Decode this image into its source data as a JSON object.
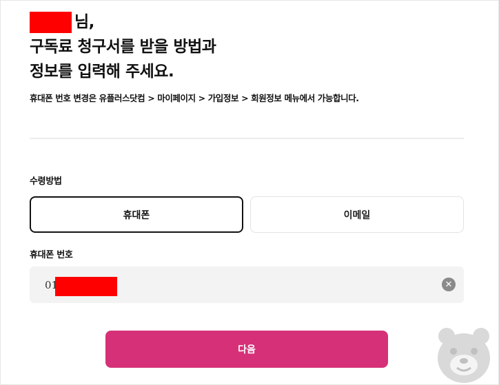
{
  "greeting": {
    "name_suffix": "님,",
    "line2": "구독료 청구서를 받을 방법과",
    "line3": "정보를 입력해 주세요."
  },
  "notice": "휴대폰 번호 변경은 유플러스닷컴 > 마이페이지 > 가입정보 > 회원정보 메뉴에서 가능합니다.",
  "receive_method": {
    "label": "수령방법",
    "options": [
      "휴대폰",
      "이메일"
    ],
    "selected": "휴대폰"
  },
  "phone": {
    "label": "휴대폰 번호",
    "value_prefix": "01"
  },
  "clear_icon": "clear-circle-icon",
  "next_button": "다음",
  "colors": {
    "accent": "#d63078",
    "field_bg": "#f3f3f3",
    "selected_border": "#111111"
  }
}
